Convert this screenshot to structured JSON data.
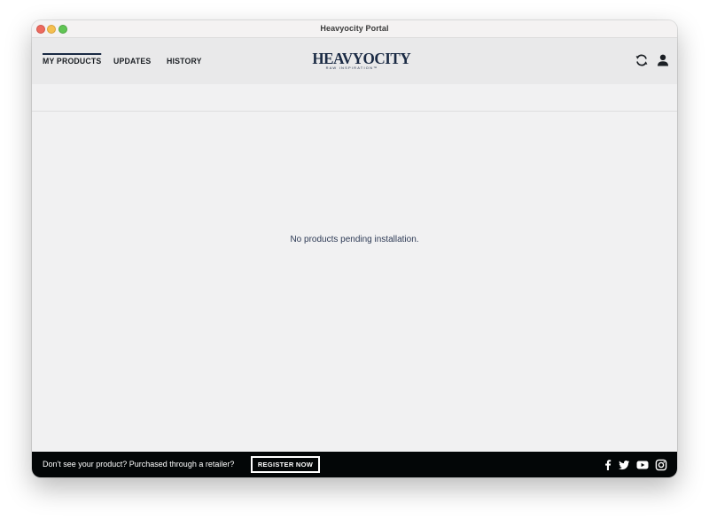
{
  "window": {
    "title": "Heavyocity Portal"
  },
  "nav": {
    "tabs": [
      {
        "label": "MY PRODUCTS",
        "active": true
      },
      {
        "label": "UPDATES",
        "active": false
      },
      {
        "label": "HISTORY",
        "active": false
      }
    ]
  },
  "logo": {
    "wordmark": "HEAVYOCITY",
    "tagline": "RAW INSPIRATION™"
  },
  "header_icons": [
    "refresh-icon",
    "user-icon"
  ],
  "main": {
    "empty_message": "No products pending installation."
  },
  "footer": {
    "prompt": "Don't see your product? Purchased through a retailer?",
    "register_label": "REGISTER NOW",
    "social_icons": [
      "facebook-icon",
      "twitter-icon",
      "youtube-icon",
      "instagram-icon"
    ]
  },
  "colors": {
    "accent": "#1a2a44",
    "header_bg": "#e9e9ea",
    "content_bg": "#f1f1f2",
    "footer_bg": "#030607",
    "message_text": "#2d3a55"
  }
}
